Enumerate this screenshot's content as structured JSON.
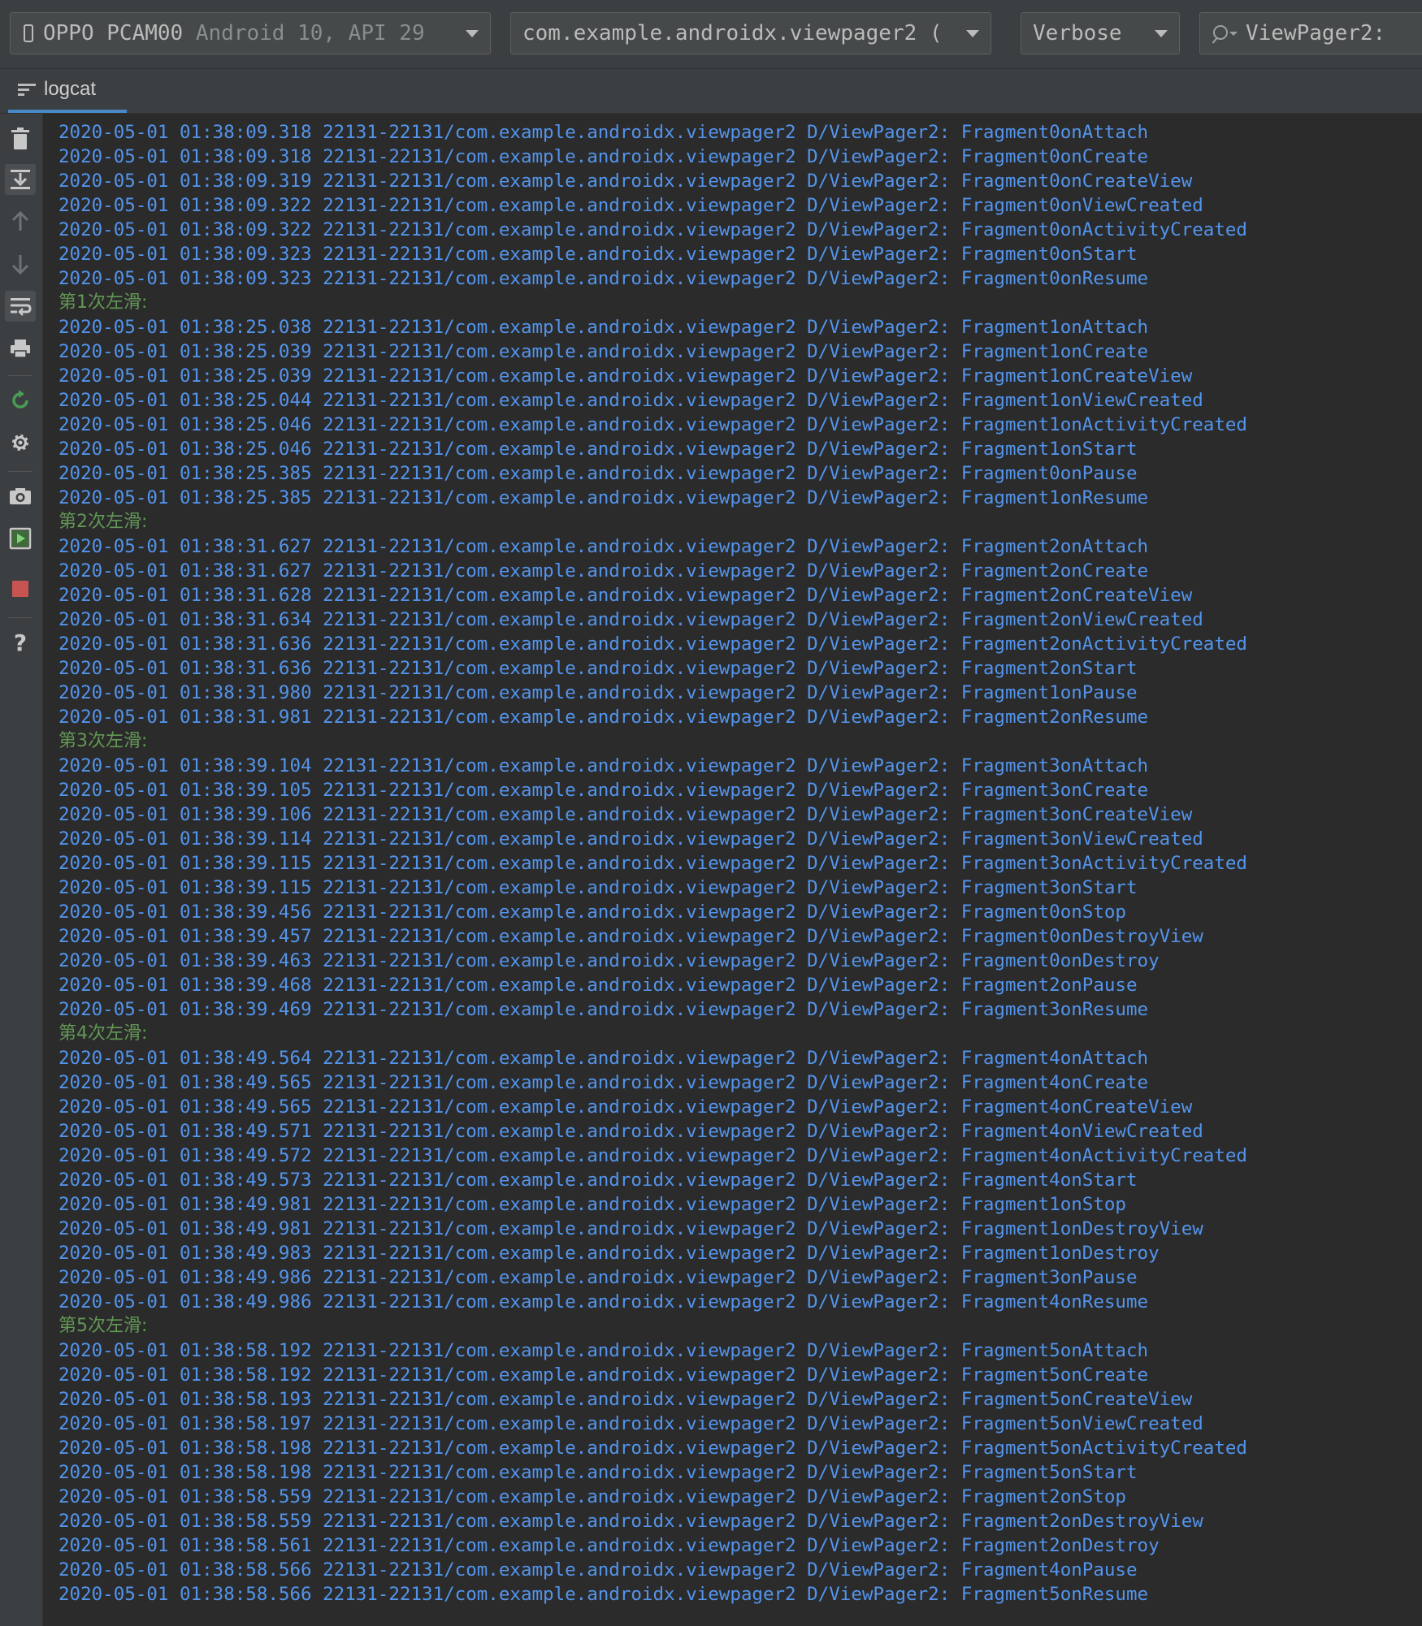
{
  "toolbar": {
    "device": {
      "name": "OPPO PCAM00",
      "api": "Android 10, API 29"
    },
    "process": "com.example.androidx.viewpager2 (",
    "log_level": "Verbose",
    "search": "ViewPager2:"
  },
  "tab": {
    "label": "logcat"
  },
  "rail": {
    "icons": [
      "trash-icon",
      "scroll-to-end-icon",
      "up-arrow-icon",
      "down-arrow-icon",
      "soft-wrap-icon",
      "print-icon",
      "restart-icon",
      "settings-icon",
      "screenshot-icon",
      "screen-record-icon",
      "stop-icon",
      "help-icon"
    ]
  },
  "log": {
    "lines": [
      {
        "kind": "log",
        "text": "2020-05-01 01:38:09.318 22131-22131/com.example.androidx.viewpager2 D/ViewPager2: Fragment0onAttach"
      },
      {
        "kind": "log",
        "text": "2020-05-01 01:38:09.318 22131-22131/com.example.androidx.viewpager2 D/ViewPager2: Fragment0onCreate"
      },
      {
        "kind": "log",
        "text": "2020-05-01 01:38:09.319 22131-22131/com.example.androidx.viewpager2 D/ViewPager2: Fragment0onCreateView"
      },
      {
        "kind": "log",
        "text": "2020-05-01 01:38:09.322 22131-22131/com.example.androidx.viewpager2 D/ViewPager2: Fragment0onViewCreated"
      },
      {
        "kind": "log",
        "text": "2020-05-01 01:38:09.322 22131-22131/com.example.androidx.viewpager2 D/ViewPager2: Fragment0onActivityCreated"
      },
      {
        "kind": "log",
        "text": "2020-05-01 01:38:09.323 22131-22131/com.example.androidx.viewpager2 D/ViewPager2: Fragment0onStart"
      },
      {
        "kind": "log",
        "text": "2020-05-01 01:38:09.323 22131-22131/com.example.androidx.viewpager2 D/ViewPager2: Fragment0onResume"
      },
      {
        "kind": "note",
        "text": "第1次左滑:"
      },
      {
        "kind": "log",
        "text": "2020-05-01 01:38:25.038 22131-22131/com.example.androidx.viewpager2 D/ViewPager2: Fragment1onAttach"
      },
      {
        "kind": "log",
        "text": "2020-05-01 01:38:25.039 22131-22131/com.example.androidx.viewpager2 D/ViewPager2: Fragment1onCreate"
      },
      {
        "kind": "log",
        "text": "2020-05-01 01:38:25.039 22131-22131/com.example.androidx.viewpager2 D/ViewPager2: Fragment1onCreateView"
      },
      {
        "kind": "log",
        "text": "2020-05-01 01:38:25.044 22131-22131/com.example.androidx.viewpager2 D/ViewPager2: Fragment1onViewCreated"
      },
      {
        "kind": "log",
        "text": "2020-05-01 01:38:25.046 22131-22131/com.example.androidx.viewpager2 D/ViewPager2: Fragment1onActivityCreated"
      },
      {
        "kind": "log",
        "text": "2020-05-01 01:38:25.046 22131-22131/com.example.androidx.viewpager2 D/ViewPager2: Fragment1onStart"
      },
      {
        "kind": "log",
        "text": "2020-05-01 01:38:25.385 22131-22131/com.example.androidx.viewpager2 D/ViewPager2: Fragment0onPause"
      },
      {
        "kind": "log",
        "text": "2020-05-01 01:38:25.385 22131-22131/com.example.androidx.viewpager2 D/ViewPager2: Fragment1onResume"
      },
      {
        "kind": "note",
        "text": "第2次左滑:"
      },
      {
        "kind": "log",
        "text": "2020-05-01 01:38:31.627 22131-22131/com.example.androidx.viewpager2 D/ViewPager2: Fragment2onAttach"
      },
      {
        "kind": "log",
        "text": "2020-05-01 01:38:31.627 22131-22131/com.example.androidx.viewpager2 D/ViewPager2: Fragment2onCreate"
      },
      {
        "kind": "log",
        "text": "2020-05-01 01:38:31.628 22131-22131/com.example.androidx.viewpager2 D/ViewPager2: Fragment2onCreateView"
      },
      {
        "kind": "log",
        "text": "2020-05-01 01:38:31.634 22131-22131/com.example.androidx.viewpager2 D/ViewPager2: Fragment2onViewCreated"
      },
      {
        "kind": "log",
        "text": "2020-05-01 01:38:31.636 22131-22131/com.example.androidx.viewpager2 D/ViewPager2: Fragment2onActivityCreated"
      },
      {
        "kind": "log",
        "text": "2020-05-01 01:38:31.636 22131-22131/com.example.androidx.viewpager2 D/ViewPager2: Fragment2onStart"
      },
      {
        "kind": "log",
        "text": "2020-05-01 01:38:31.980 22131-22131/com.example.androidx.viewpager2 D/ViewPager2: Fragment1onPause"
      },
      {
        "kind": "log",
        "text": "2020-05-01 01:38:31.981 22131-22131/com.example.androidx.viewpager2 D/ViewPager2: Fragment2onResume"
      },
      {
        "kind": "note",
        "text": "第3次左滑:"
      },
      {
        "kind": "log",
        "text": "2020-05-01 01:38:39.104 22131-22131/com.example.androidx.viewpager2 D/ViewPager2: Fragment3onAttach"
      },
      {
        "kind": "log",
        "text": "2020-05-01 01:38:39.105 22131-22131/com.example.androidx.viewpager2 D/ViewPager2: Fragment3onCreate"
      },
      {
        "kind": "log",
        "text": "2020-05-01 01:38:39.106 22131-22131/com.example.androidx.viewpager2 D/ViewPager2: Fragment3onCreateView"
      },
      {
        "kind": "log",
        "text": "2020-05-01 01:38:39.114 22131-22131/com.example.androidx.viewpager2 D/ViewPager2: Fragment3onViewCreated"
      },
      {
        "kind": "log",
        "text": "2020-05-01 01:38:39.115 22131-22131/com.example.androidx.viewpager2 D/ViewPager2: Fragment3onActivityCreated"
      },
      {
        "kind": "log",
        "text": "2020-05-01 01:38:39.115 22131-22131/com.example.androidx.viewpager2 D/ViewPager2: Fragment3onStart"
      },
      {
        "kind": "log",
        "text": "2020-05-01 01:38:39.456 22131-22131/com.example.androidx.viewpager2 D/ViewPager2: Fragment0onStop"
      },
      {
        "kind": "log",
        "text": "2020-05-01 01:38:39.457 22131-22131/com.example.androidx.viewpager2 D/ViewPager2: Fragment0onDestroyView"
      },
      {
        "kind": "log",
        "text": "2020-05-01 01:38:39.463 22131-22131/com.example.androidx.viewpager2 D/ViewPager2: Fragment0onDestroy"
      },
      {
        "kind": "log",
        "text": "2020-05-01 01:38:39.468 22131-22131/com.example.androidx.viewpager2 D/ViewPager2: Fragment2onPause"
      },
      {
        "kind": "log",
        "text": "2020-05-01 01:38:39.469 22131-22131/com.example.androidx.viewpager2 D/ViewPager2: Fragment3onResume"
      },
      {
        "kind": "note",
        "text": "第4次左滑:"
      },
      {
        "kind": "log",
        "text": "2020-05-01 01:38:49.564 22131-22131/com.example.androidx.viewpager2 D/ViewPager2: Fragment4onAttach"
      },
      {
        "kind": "log",
        "text": "2020-05-01 01:38:49.565 22131-22131/com.example.androidx.viewpager2 D/ViewPager2: Fragment4onCreate"
      },
      {
        "kind": "log",
        "text": "2020-05-01 01:38:49.565 22131-22131/com.example.androidx.viewpager2 D/ViewPager2: Fragment4onCreateView"
      },
      {
        "kind": "log",
        "text": "2020-05-01 01:38:49.571 22131-22131/com.example.androidx.viewpager2 D/ViewPager2: Fragment4onViewCreated"
      },
      {
        "kind": "log",
        "text": "2020-05-01 01:38:49.572 22131-22131/com.example.androidx.viewpager2 D/ViewPager2: Fragment4onActivityCreated"
      },
      {
        "kind": "log",
        "text": "2020-05-01 01:38:49.573 22131-22131/com.example.androidx.viewpager2 D/ViewPager2: Fragment4onStart"
      },
      {
        "kind": "log",
        "text": "2020-05-01 01:38:49.981 22131-22131/com.example.androidx.viewpager2 D/ViewPager2: Fragment1onStop"
      },
      {
        "kind": "log",
        "text": "2020-05-01 01:38:49.981 22131-22131/com.example.androidx.viewpager2 D/ViewPager2: Fragment1onDestroyView"
      },
      {
        "kind": "log",
        "text": "2020-05-01 01:38:49.983 22131-22131/com.example.androidx.viewpager2 D/ViewPager2: Fragment1onDestroy"
      },
      {
        "kind": "log",
        "text": "2020-05-01 01:38:49.986 22131-22131/com.example.androidx.viewpager2 D/ViewPager2: Fragment3onPause"
      },
      {
        "kind": "log",
        "text": "2020-05-01 01:38:49.986 22131-22131/com.example.androidx.viewpager2 D/ViewPager2: Fragment4onResume"
      },
      {
        "kind": "note",
        "text": "第5次左滑:"
      },
      {
        "kind": "log",
        "text": "2020-05-01 01:38:58.192 22131-22131/com.example.androidx.viewpager2 D/ViewPager2: Fragment5onAttach"
      },
      {
        "kind": "log",
        "text": "2020-05-01 01:38:58.192 22131-22131/com.example.androidx.viewpager2 D/ViewPager2: Fragment5onCreate"
      },
      {
        "kind": "log",
        "text": "2020-05-01 01:38:58.193 22131-22131/com.example.androidx.viewpager2 D/ViewPager2: Fragment5onCreateView"
      },
      {
        "kind": "log",
        "text": "2020-05-01 01:38:58.197 22131-22131/com.example.androidx.viewpager2 D/ViewPager2: Fragment5onViewCreated"
      },
      {
        "kind": "log",
        "text": "2020-05-01 01:38:58.198 22131-22131/com.example.androidx.viewpager2 D/ViewPager2: Fragment5onActivityCreated"
      },
      {
        "kind": "log",
        "text": "2020-05-01 01:38:58.198 22131-22131/com.example.androidx.viewpager2 D/ViewPager2: Fragment5onStart"
      },
      {
        "kind": "log",
        "text": "2020-05-01 01:38:58.559 22131-22131/com.example.androidx.viewpager2 D/ViewPager2: Fragment2onStop"
      },
      {
        "kind": "log",
        "text": "2020-05-01 01:38:58.559 22131-22131/com.example.androidx.viewpager2 D/ViewPager2: Fragment2onDestroyView"
      },
      {
        "kind": "log",
        "text": "2020-05-01 01:38:58.561 22131-22131/com.example.androidx.viewpager2 D/ViewPager2: Fragment2onDestroy"
      },
      {
        "kind": "log",
        "text": "2020-05-01 01:38:58.566 22131-22131/com.example.androidx.viewpager2 D/ViewPager2: Fragment4onPause"
      },
      {
        "kind": "log",
        "text": "2020-05-01 01:38:58.566 22131-22131/com.example.androidx.viewpager2 D/ViewPager2: Fragment5onResume"
      }
    ]
  },
  "colors": {
    "log_text": "#5394ec",
    "note_text": "#629755",
    "background": "#2b2b2b",
    "toolbar": "#3c3f41",
    "accent": "#4a88c7"
  }
}
